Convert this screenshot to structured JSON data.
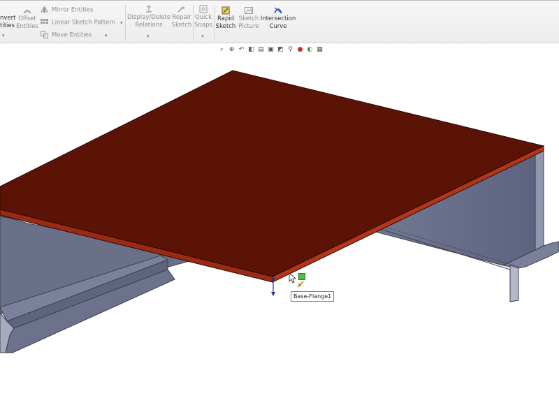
{
  "ribbon": {
    "convert": {
      "line1": "nvert",
      "line2": "tities"
    },
    "offset": {
      "line1": "Offset",
      "line2": "Entities"
    },
    "mirror": "Mirror Entities",
    "linear_pattern": "Linear Sketch Pattern",
    "move": "Move Entities",
    "display_delete": {
      "line1": "Display/Delete",
      "line2": "Relations"
    },
    "repair": {
      "line1": "Repair",
      "line2": "Sketch"
    },
    "quick_snaps": {
      "line1": "Quick",
      "line2": "Snaps"
    },
    "rapid_sketch": {
      "line1": "Rapid",
      "line2": "Sketch"
    },
    "sketch_picture": {
      "line1": "Sketch",
      "line2": "Picture"
    },
    "intersection_curve": {
      "line1": "Intersection",
      "line2": "Curve"
    }
  },
  "heads_up_toolbar": {
    "icons": [
      "zoom-to-fit-icon",
      "zoom-area-icon",
      "previous-view-icon",
      "section-view-icon",
      "dynamic-annotation-icon",
      "view-orientation-icon",
      "display-style-icon",
      "hide-show-icon",
      "edit-appearance-icon",
      "apply-scene-icon",
      "view-settings-icon"
    ]
  },
  "tooltip": {
    "label": "Base-Flange1"
  },
  "colors": {
    "flange_top": "#5a1305",
    "flange_edge": "#9a2a12",
    "part_body": "#6f7590",
    "part_light": "#8f94ac"
  }
}
